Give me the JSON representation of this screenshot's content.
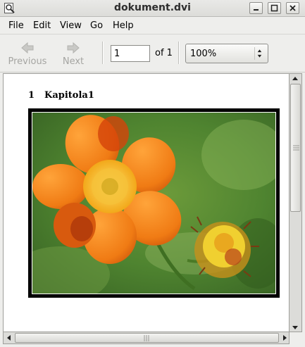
{
  "window": {
    "title": "dokument.dvi"
  },
  "menu": {
    "items": [
      "File",
      "Edit",
      "View",
      "Go",
      "Help"
    ]
  },
  "toolbar": {
    "previous_label": "Previous",
    "next_label": "Next",
    "page_value": "1",
    "page_of": "of 1",
    "zoom_value": "100%"
  },
  "document": {
    "section_number": "1",
    "section_title": "Kapitola1"
  },
  "colors": {
    "window_bg": "#eeeeec",
    "page_bg": "#ffffff",
    "frame": "#000000",
    "disabled_text": "#a5a5a2"
  }
}
